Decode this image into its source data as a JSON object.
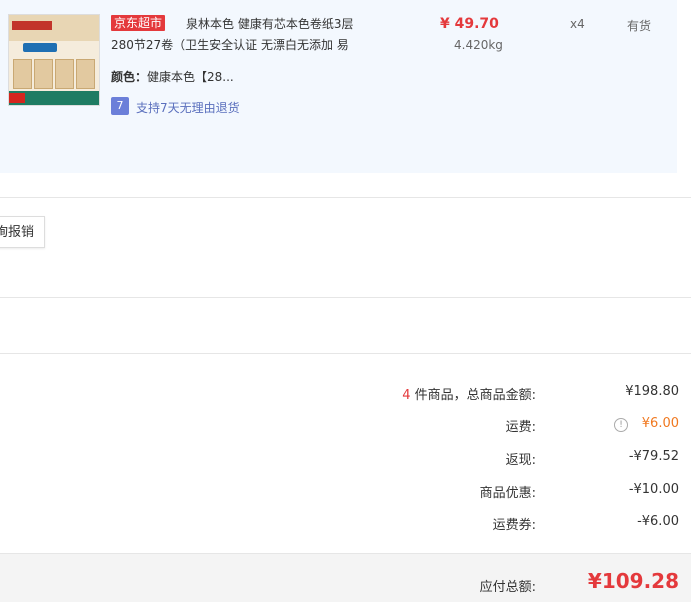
{
  "product": {
    "store_badge": "京东超市",
    "title_line1": "泉林本色 健康有芯本色卷纸3层",
    "title_line2": "280节27卷（卫生安全认证 无漂白无添加 易",
    "price": "¥ 49.70",
    "weight": "4.420kg",
    "quantity": "x4",
    "stock_status": "有货",
    "color_label": "颜色：",
    "color_value": "健康本色【28...",
    "return_icon_glyph": "7",
    "return_policy": "支持7天无理由退货"
  },
  "invoice": {
    "button_label": "询报销"
  },
  "summary": {
    "count": "4",
    "count_suffix": " 件商品，总商品金额:",
    "goods_total": "¥198.80",
    "shipping_label": "运费:",
    "shipping_value": "¥6.00",
    "rebate_label": "返现:",
    "rebate_value": "-¥79.52",
    "discount_label": "商品优惠:",
    "discount_value": "-¥10.00",
    "shipping_coupon_label": "运费券:",
    "shipping_coupon_value": "-¥6.00",
    "payable_label": "应付总额:",
    "payable_value": "¥109.28"
  },
  "colors": {
    "accent_red": "#e4393c",
    "shipping_orange": "#f0781f",
    "panel_bg": "#f3f8fe"
  },
  "icons": [
    "product-thumbnail",
    "seven-day-return-icon",
    "info-icon"
  ]
}
